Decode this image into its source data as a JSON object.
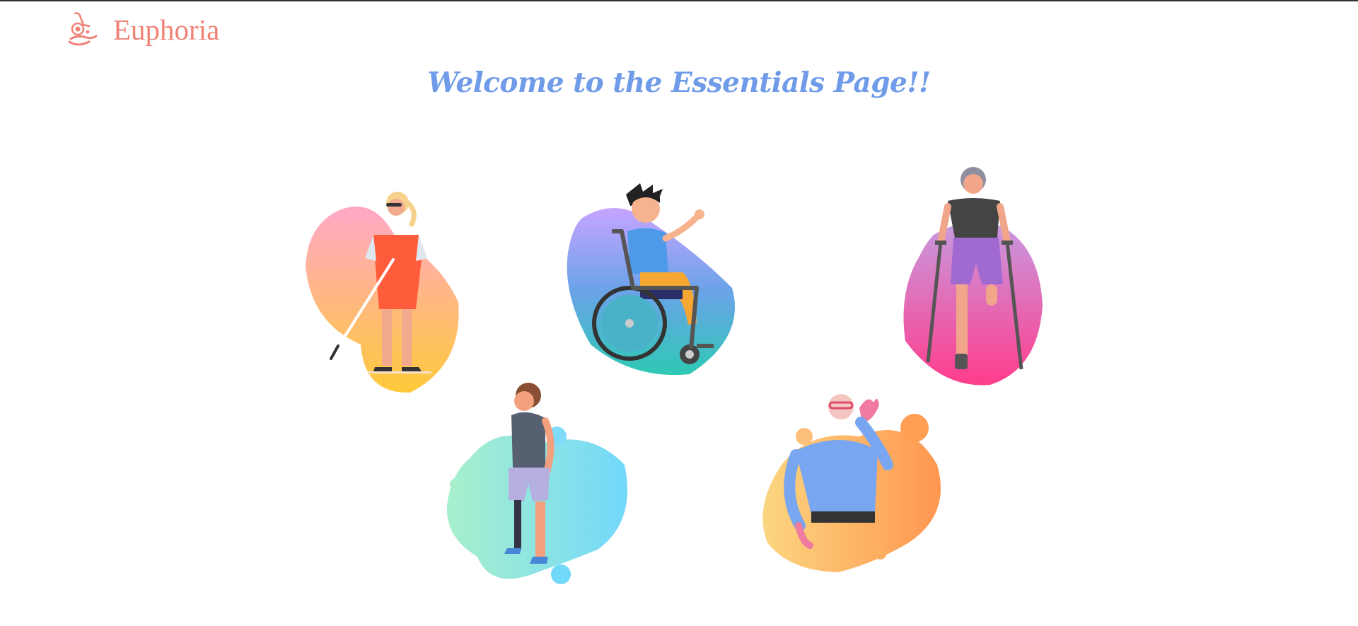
{
  "header": {
    "brand_name": "Euphoria",
    "brand_icon": "wheelchair-hand-logo-icon",
    "brand_color": "#f08276"
  },
  "main": {
    "title": "Welcome to the Essentials Page!!",
    "title_color": "#6f9be8",
    "cards": [
      {
        "icon": "visually-impaired-woman-with-cane-icon",
        "blob_colors": [
          "#ffa8c8",
          "#ffc93a"
        ]
      },
      {
        "icon": "boy-in-wheelchair-icon",
        "blob_colors": [
          "#c6a4ff",
          "#2ec9b4"
        ]
      },
      {
        "icon": "woman-with-crutches-icon",
        "blob_colors": [
          "#c79be0",
          "#ff3c8c"
        ]
      },
      {
        "icon": "man-with-prosthetic-leg-icon",
        "blob_colors": [
          "#a8f0cc",
          "#72d8fa"
        ]
      },
      {
        "icon": "elderly-man-hearing-icon",
        "blob_colors": [
          "#fbd680",
          "#ff9650"
        ]
      }
    ]
  }
}
